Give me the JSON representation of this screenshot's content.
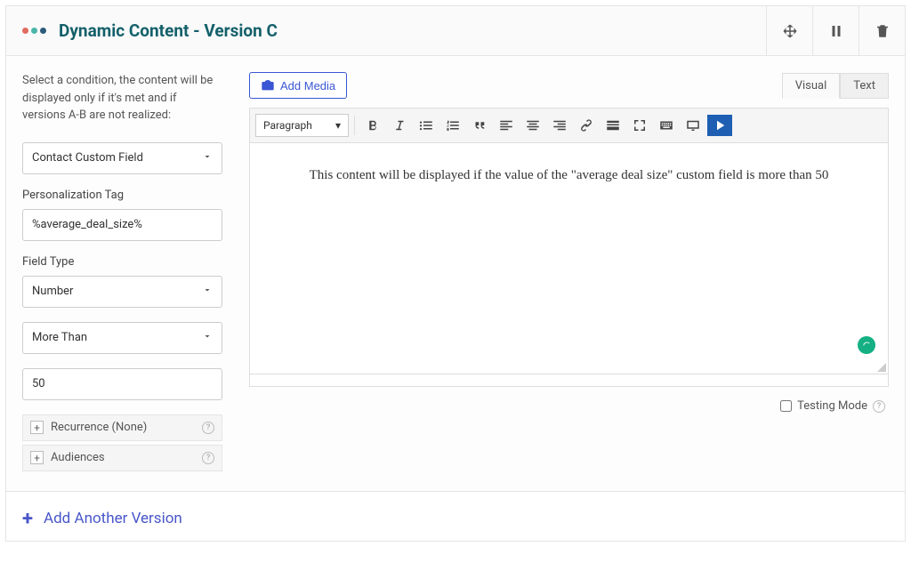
{
  "header": {
    "title": "Dynamic Content - Version C"
  },
  "sidebar": {
    "intro": "Select a condition, the content will be displayed only if it's met and if versions A-B are not realized:",
    "condition_select": "Contact Custom Field",
    "personalization_label": "Personalization Tag",
    "personalization_value": "%average_deal_size%",
    "field_type_label": "Field Type",
    "field_type_value": "Number",
    "operator_value": "More Than",
    "threshold_value": "50",
    "recurrence_label": "Recurrence (None)",
    "audiences_label": "Audiences"
  },
  "editor": {
    "add_media_label": "Add Media",
    "tab_visual": "Visual",
    "tab_text": "Text",
    "format_dropdown": "Paragraph",
    "content": "This content will be displayed if the value of the \"average deal size\" custom field is more than 50",
    "testing_mode_label": "Testing Mode"
  },
  "footer": {
    "add_version_label": "Add Another Version"
  }
}
